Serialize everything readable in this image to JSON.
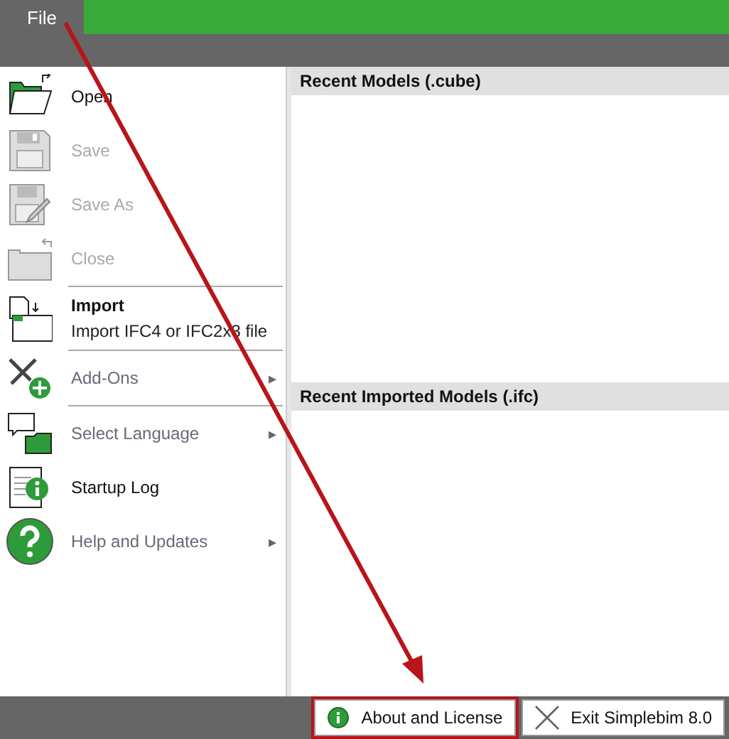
{
  "menu_bar": {
    "tab": "File"
  },
  "menu": [
    {
      "kind": "command",
      "label": "Open",
      "disabled": false,
      "divider_after": false
    },
    {
      "kind": "command",
      "label": "Save",
      "disabled": true,
      "divider_after": false
    },
    {
      "kind": "command",
      "label": "Save As",
      "disabled": true,
      "divider_after": false
    },
    {
      "kind": "command",
      "label": "Close",
      "disabled": true,
      "divider_after": true
    },
    {
      "kind": "described",
      "label": "Import",
      "description": "Import IFC4 or IFC2x3 file",
      "disabled": false,
      "divider_after": true
    },
    {
      "kind": "submenu",
      "label": "Add-Ons",
      "arrow": "▸",
      "disabled": false,
      "divider_after": true
    },
    {
      "kind": "submenu",
      "label": "Select Language",
      "arrow": "▸",
      "disabled": false,
      "divider_after": false
    },
    {
      "kind": "command",
      "label": "Startup Log",
      "disabled": false,
      "divider_after": false
    },
    {
      "kind": "submenu",
      "label": "Help and Updates",
      "arrow": "▸",
      "disabled": false,
      "divider_after": false
    }
  ],
  "sections": [
    {
      "title": "Recent Models (.cube)"
    },
    {
      "title": "Recent Imported Models (.ifc)"
    }
  ],
  "footer_buttons": [
    {
      "kind": "info",
      "label": "About and License",
      "highlighted": true
    },
    {
      "kind": "exit",
      "label": "Exit Simplebim 8.0",
      "highlighted": false
    }
  ]
}
